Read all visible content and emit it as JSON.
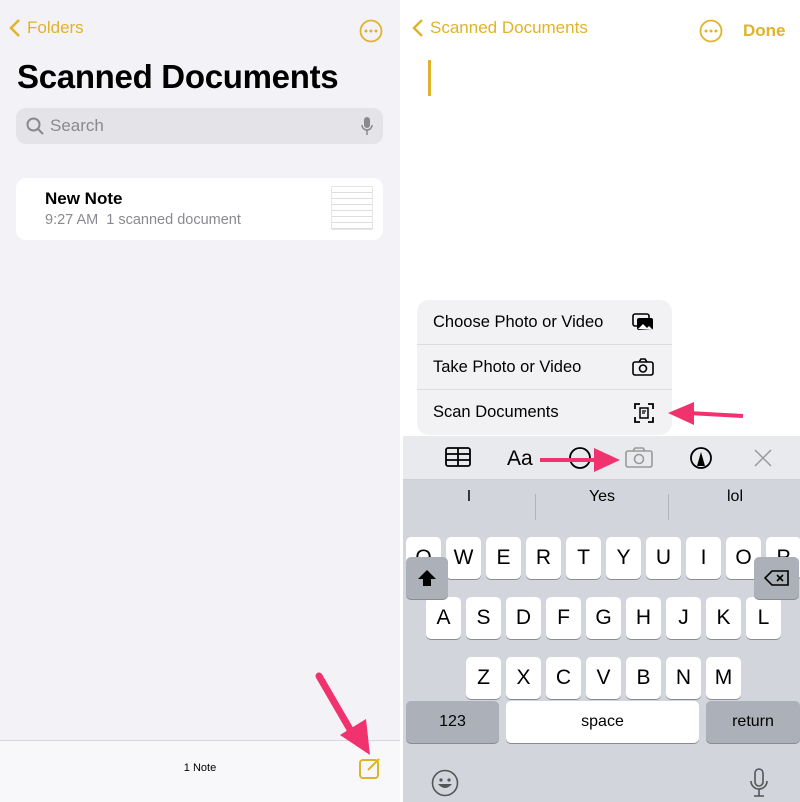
{
  "left": {
    "back_label": "Folders",
    "title": "Scanned Documents",
    "search_placeholder": "Search",
    "note": {
      "title": "New Note",
      "time": "9:27 AM",
      "subtitle": "1 scanned document"
    },
    "footer_count": "1 Note"
  },
  "right": {
    "back_label": "Scanned Documents",
    "done_label": "Done",
    "menu": [
      {
        "label": "Choose Photo or Video",
        "icon": "photo-library-icon"
      },
      {
        "label": "Take Photo or Video",
        "icon": "camera-icon"
      },
      {
        "label": "Scan Documents",
        "icon": "scan-document-icon"
      }
    ],
    "toolbar": {
      "format_label": "Aa"
    },
    "suggestions": [
      "I",
      "Yes",
      "lol"
    ],
    "keyboard": {
      "rows": [
        [
          "Q",
          "W",
          "E",
          "R",
          "T",
          "Y",
          "U",
          "I",
          "O",
          "P"
        ],
        [
          "A",
          "S",
          "D",
          "F",
          "G",
          "H",
          "J",
          "K",
          "L"
        ],
        [
          "Z",
          "X",
          "C",
          "V",
          "B",
          "N",
          "M"
        ]
      ],
      "numbers_label": "123",
      "space_label": "space",
      "return_label": "return"
    }
  },
  "colors": {
    "accent": "#e0b32a",
    "arrow": "#f0326e"
  }
}
